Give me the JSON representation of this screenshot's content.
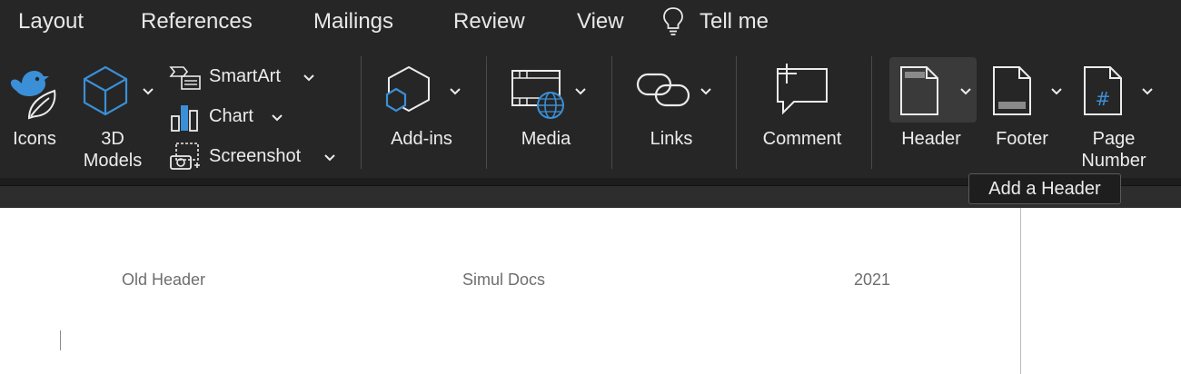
{
  "tabs": [
    "Layout",
    "References",
    "Mailings",
    "Review",
    "View",
    "Tell me"
  ],
  "tellme_icon": "lightbulb-icon",
  "ribbon": {
    "icons_label": "Icons",
    "models_label": "3D\nModels",
    "smartart_label": "SmartArt",
    "chart_label": "Chart",
    "screenshot_label": "Screenshot",
    "addins_label": "Add-ins",
    "media_label": "Media",
    "links_label": "Links",
    "comment_label": "Comment",
    "header_label": "Header",
    "footer_label": "Footer",
    "page_number_label": "Page\nNumber",
    "page_number_glyph": "#"
  },
  "tooltip": "Add a Header",
  "document": {
    "header_left": "Old Header",
    "header_center": "Simul Docs",
    "header_right": "2021"
  },
  "colors": {
    "ribbon_bg": "#262626",
    "icon_accent": "#3b8fd6",
    "text": "#ececec"
  }
}
